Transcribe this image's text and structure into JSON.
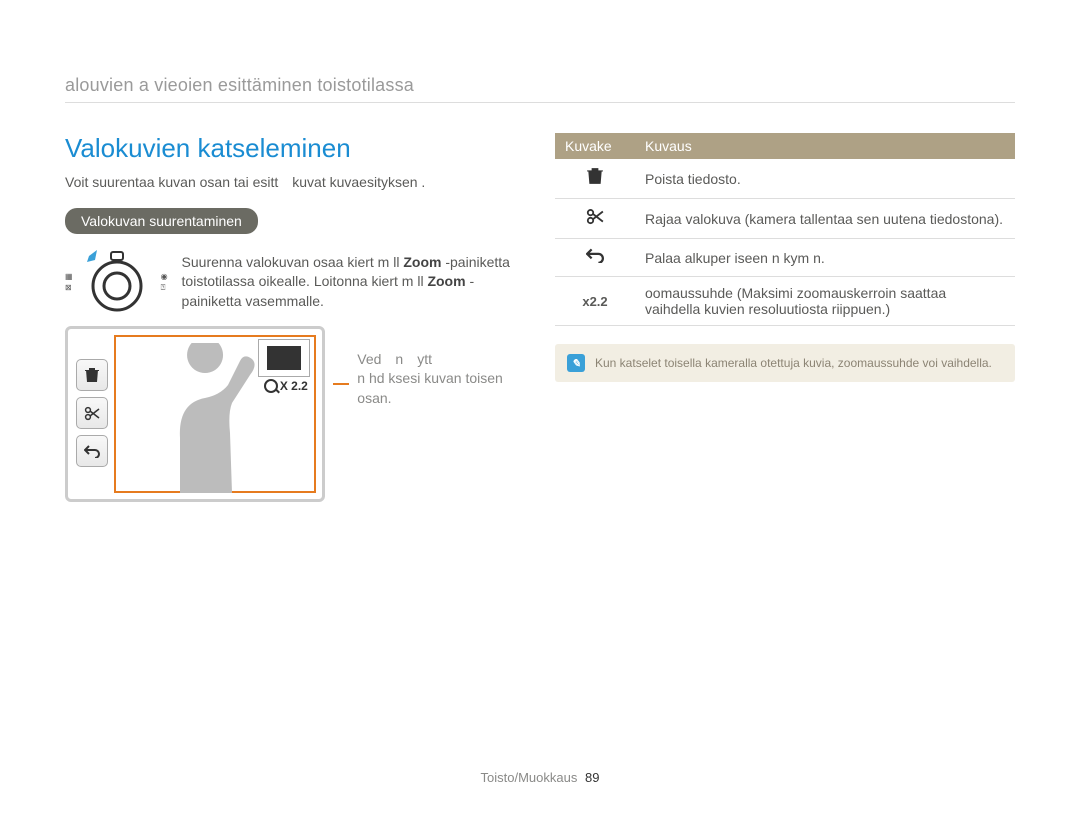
{
  "breadcrumb": "alouvien a vieoien esittäminen toistotilassa",
  "section_title": "Valokuvien katseleminen",
  "intro": "Voit suurentaa kuvan osan tai esitt kuvat kuvaesityksen .",
  "pill": "Valokuvan suurentaminen",
  "instruction": {
    "pre": "Suurenna valokuvan osaa kiert  m  ll  ",
    "zoom1": "Zoom",
    "mid": " -painiketta toistotilassa oikealle. Loitonna kiert  m  ll  ",
    "zoom2": "Zoom",
    "post": " -painiketta vasemmalle."
  },
  "screen": {
    "zoom_text": "X 2.2"
  },
  "callout": "Ved n ytt\nn  hd  ksesi kuvan toisen osan.",
  "table": {
    "headers": {
      "icon": "Kuvake",
      "desc": "Kuvaus"
    },
    "rows": [
      {
        "icon": "trash",
        "desc": "Poista tiedosto."
      },
      {
        "icon": "scissors",
        "desc": "Rajaa valokuva (kamera tallentaa sen uutena tiedostona)."
      },
      {
        "icon": "return",
        "desc": "Palaa alkuper  iseen n  kym   n."
      },
      {
        "icon": "x22",
        "label": "x2.2",
        "desc": "oomaussuhde (Maksimi zoomauskerroin saattaa vaihdella kuvien resoluutiosta riippuen.)"
      }
    ]
  },
  "note": "Kun katselet toisella kameralla otettuja kuvia, zoomaussuhde voi vaihdella.",
  "footer": {
    "label": "Toisto/Muokkaus",
    "page": "89"
  }
}
